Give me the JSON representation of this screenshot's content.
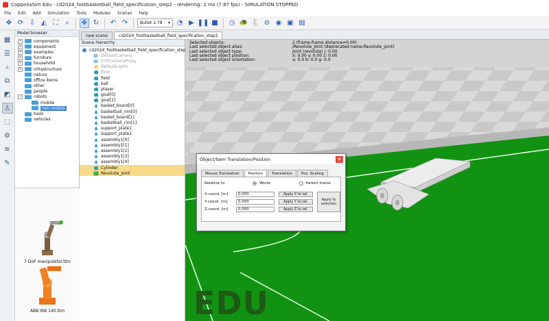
{
  "window": {
    "title": "CoppeliaSim Edu - cd2024_footbasketball_field_specification_step2 - rendering: 2 ms (7.87 fps) - SIMULATION STOPPED"
  },
  "menu": [
    "File",
    "Edit",
    "Add",
    "Simulation",
    "Tools",
    "Modules",
    "Scenes",
    "Help"
  ],
  "toolbar": {
    "solver_label": "Bullet 2.78"
  },
  "model_browser": {
    "header": "Model browser",
    "items": [
      {
        "label": "components",
        "expandable": true
      },
      {
        "label": "equipment",
        "expandable": true
      },
      {
        "label": "examples",
        "expandable": true
      },
      {
        "label": "furniture",
        "expandable": true
      },
      {
        "label": "household",
        "expandable": true
      },
      {
        "label": "infrastructure",
        "expandable": true
      },
      {
        "label": "nature",
        "expandable": false
      },
      {
        "label": "office items",
        "expandable": false
      },
      {
        "label": "other",
        "expandable": false
      },
      {
        "label": "people",
        "expandable": false
      },
      {
        "label": "robots",
        "expandable": true
      },
      {
        "label": "mobile",
        "expandable": false
      },
      {
        "label": "non-mobile",
        "expandable": false,
        "selected": true
      },
      {
        "label": "tools",
        "expandable": false
      },
      {
        "label": "vehicles",
        "expandable": false
      }
    ],
    "thumbnails": [
      {
        "label": "7 DoF manipulator.ttm"
      },
      {
        "label": "ABB IRB 140.ttm"
      }
    ]
  },
  "scene_tabs": [
    {
      "label": "new scene",
      "active": false
    },
    {
      "label": "cd2024_footbasketball_field_specification_step2",
      "active": true
    }
  ],
  "hierarchy": {
    "header": "Scene hierarchy",
    "items": [
      {
        "label": "cd2024_footbasketball_field_specification_step2",
        "indent": 0,
        "icon": "scene"
      },
      {
        "label": "DefaultCamera",
        "indent": 1,
        "icon": "camera",
        "grey": true
      },
      {
        "label": "XYZCameraProxy",
        "indent": 1,
        "icon": "camera",
        "grey": true
      },
      {
        "label": "DefaultLights",
        "indent": 1,
        "icon": "light",
        "grey": true
      },
      {
        "label": "floor",
        "indent": 1,
        "icon": "shape",
        "grey": true
      },
      {
        "label": "field",
        "indent": 1,
        "icon": "shape"
      },
      {
        "label": "ball",
        "indent": 1,
        "icon": "shape"
      },
      {
        "label": "player",
        "indent": 1,
        "icon": "shape"
      },
      {
        "label": "goal[0]",
        "indent": 1,
        "icon": "shape"
      },
      {
        "label": "goal[1]",
        "indent": 1,
        "icon": "shape"
      },
      {
        "label": "basket_board[0]",
        "indent": 1,
        "icon": "dummy"
      },
      {
        "label": "basketball_rim[0]",
        "indent": 1,
        "icon": "dummy"
      },
      {
        "label": "basket_board[1]",
        "indent": 1,
        "icon": "dummy"
      },
      {
        "label": "basketball_rim[1]",
        "indent": 1,
        "icon": "dummy"
      },
      {
        "label": "support_plate1",
        "indent": 1,
        "icon": "dummy"
      },
      {
        "label": "support_plate2",
        "indent": 1,
        "icon": "dummy"
      },
      {
        "label": "assembly1[0]",
        "indent": 1,
        "icon": "dummy"
      },
      {
        "label": "assembly1[1]",
        "indent": 1,
        "icon": "dummy"
      },
      {
        "label": "assembly1[2]",
        "indent": 1,
        "icon": "dummy"
      },
      {
        "label": "assembly1[3]",
        "indent": 1,
        "icon": "dummy"
      },
      {
        "label": "assembly1[4]",
        "indent": 1,
        "icon": "dummy"
      },
      {
        "label": "Cylinder",
        "indent": 1,
        "icon": "shape",
        "selected": true
      },
      {
        "label": "Revolute_joint",
        "indent": 1,
        "icon": "joint",
        "selected": true
      }
    ]
  },
  "viewport_info": {
    "labels": [
      "Selected objects:",
      "Last selected object alias:",
      "Last selected object type:",
      "Last selected object position:",
      "Last selected object orientation:"
    ],
    "values": [
      "2 (frame-frame distance=0.00)",
      "/Revolute_joint   (deprecated name:Revolute_joint)",
      "Joint (revolute) j: 0.00",
      "x: 0.00    y: 0.00    z: 0.00",
      "a: 0.0    b: 0.0    g: 0.0"
    ],
    "watermark": "EDU"
  },
  "dialog": {
    "title": "Object/Item Translation/Position",
    "close_glyph": "✕",
    "tabs": [
      "Mouse Translation",
      "Position",
      "Translation",
      "Pos. Scaling"
    ],
    "active_tab": 1,
    "relative_to_label": "Relative to",
    "radio_world": "World",
    "radio_parent": "Parent frame",
    "fields": [
      {
        "label": "X-coord. [m]",
        "value": "0.000",
        "button": "Apply X to sel."
      },
      {
        "label": "Y-coord. [m]",
        "value": "0.000",
        "button": "Apply Y to sel."
      },
      {
        "label": "Z-coord. [m]",
        "value": "0.000",
        "button": "Apply Z to sel."
      }
    ],
    "apply_selection_button": "Apply to selection"
  },
  "colors": {
    "accent": "#3a83d6",
    "field_green": "#129212",
    "selection": "#f6dc8a"
  }
}
